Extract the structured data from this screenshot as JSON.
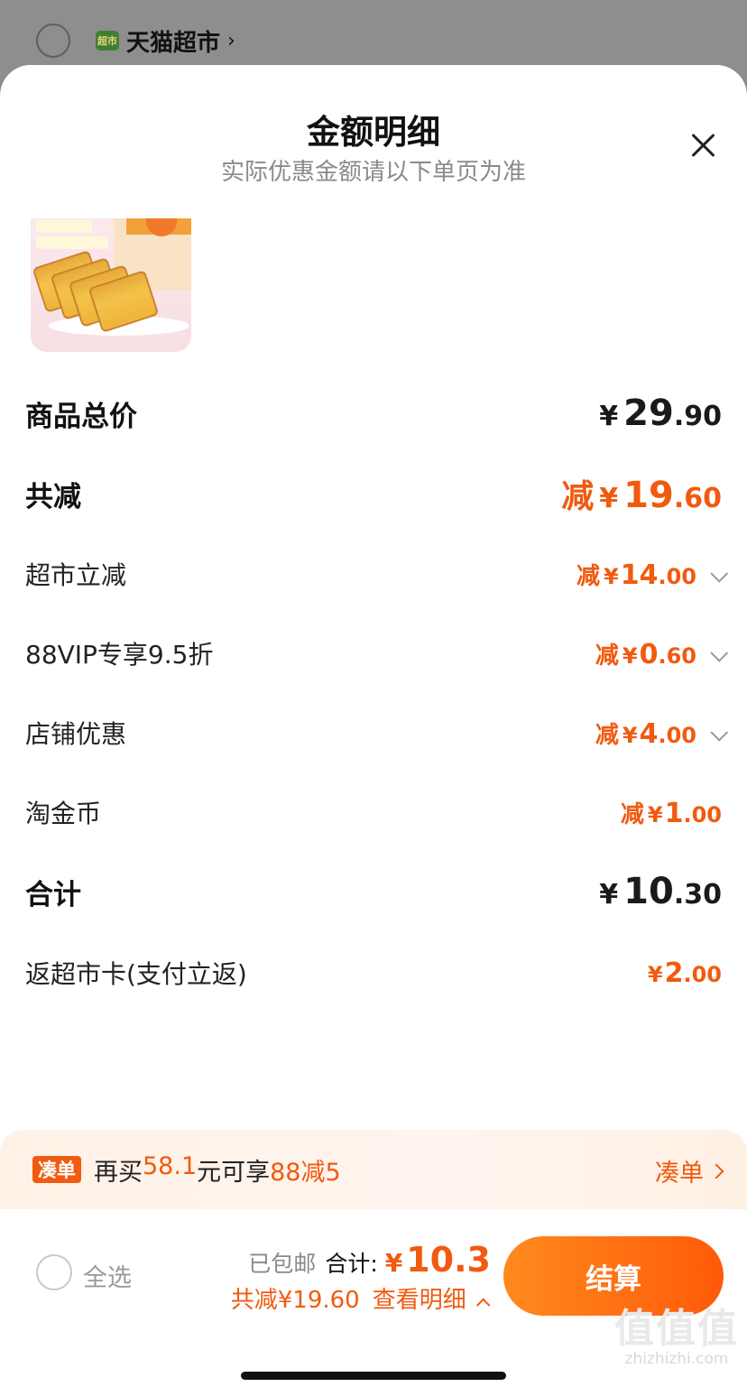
{
  "background": {
    "store_name": "天猫超市",
    "store_logo_text": "超市"
  },
  "sheet": {
    "title": "金额明细",
    "subtitle": "实际优惠金额请以下单页为准"
  },
  "rows": {
    "subtotal": {
      "label": "商品总价",
      "yen": "¥",
      "int": "29",
      "dec": ".90"
    },
    "total_discount": {
      "label": "共减",
      "prefix": "减",
      "yen": "¥",
      "int": "19",
      "dec": ".60"
    },
    "supermarket_off": {
      "label": "超市立减",
      "prefix": "减",
      "yen": "¥",
      "int": "14",
      "dec": ".00"
    },
    "vip": {
      "label": "88VIP专享9.5折",
      "prefix": "减",
      "yen": "¥",
      "int": "0",
      "dec": ".60"
    },
    "store_coupon": {
      "label": "店铺优惠",
      "prefix": "减",
      "yen": "¥",
      "int": "4",
      "dec": ".00"
    },
    "taojinbi": {
      "label": "淘金币",
      "prefix": "减",
      "yen": "¥",
      "int": "1",
      "dec": ".00"
    },
    "total": {
      "label": "合计",
      "yen": "¥",
      "int": "10",
      "dec": ".30"
    },
    "cashback": {
      "label": "返超市卡(支付立返)",
      "yen": "¥",
      "int": "2",
      "dec": ".00"
    }
  },
  "promo": {
    "badge": "凑单",
    "text_a": "再买",
    "text_amount": "58.1",
    "text_b": "元可享",
    "text_deal": "88减5",
    "link": "凑单"
  },
  "bottom": {
    "select_all": "全选",
    "shipping": "已包邮",
    "total_label": "合计:",
    "total_yen": "¥",
    "total_value": "10.3",
    "saved": "共减¥19.60",
    "details_link": "查看明细",
    "checkout": "结算"
  },
  "watermark": {
    "glyphs": "值值值",
    "url": "zhizhizhi.com"
  },
  "colors": {
    "accent": "#f15a0f",
    "button_gradient_start": "#ff8a1f",
    "button_gradient_end": "#ff5a08"
  }
}
